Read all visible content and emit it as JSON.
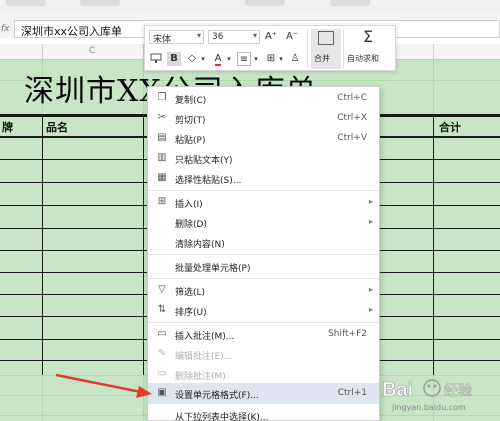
{
  "formula_bar": {
    "fx": "fx",
    "value": "深圳市xx公司入库单"
  },
  "columns": {
    "c": "C"
  },
  "sheet": {
    "title": "深圳市XX公司入库单",
    "headers": {
      "col1": "牌",
      "col2": "品名",
      "col3": "合计"
    }
  },
  "mini_toolbar": {
    "font_name": "宋体",
    "font_size": "36",
    "increase_font": "A⁺",
    "decrease_font": "A⁻",
    "bold": "B",
    "merge_label": "合并",
    "autosum_label": "自动求和"
  },
  "context_menu": {
    "items": [
      {
        "label": "复制(C)",
        "shortcut": "Ctrl+C",
        "icon": "copy-icon"
      },
      {
        "label": "剪切(T)",
        "shortcut": "Ctrl+X",
        "icon": "scissors-icon"
      },
      {
        "label": "粘贴(P)",
        "shortcut": "Ctrl+V",
        "icon": "paste-icon"
      },
      {
        "label": "只粘贴文本(Y)",
        "shortcut": "",
        "icon": "paste-text-icon"
      },
      {
        "label": "选择性粘贴(S)...",
        "shortcut": "",
        "icon": "paste-special-icon"
      },
      {
        "label": "插入(I)",
        "shortcut": "",
        "icon": "insert-cells-icon"
      },
      {
        "label": "删除(D)",
        "shortcut": "",
        "icon": ""
      },
      {
        "label": "清除内容(N)",
        "shortcut": "",
        "icon": ""
      },
      {
        "label": "批量处理单元格(P)",
        "shortcut": "",
        "icon": ""
      },
      {
        "label": "筛选(L)",
        "shortcut": "",
        "icon": "filter-icon"
      },
      {
        "label": "排序(U)",
        "shortcut": "",
        "icon": "sort-icon"
      },
      {
        "label": "插入批注(M)...",
        "shortcut": "Shift+F2",
        "icon": "comment-icon"
      },
      {
        "label": "编辑批注(E)...",
        "shortcut": "",
        "icon": "edit-comment-icon"
      },
      {
        "label": "删除批注(M)",
        "shortcut": "",
        "icon": "delete-comment-icon"
      },
      {
        "label": "设置单元格格式(F)...",
        "shortcut": "Ctrl+1",
        "icon": "format-cells-icon"
      },
      {
        "label": "从下拉列表中选择(K)...",
        "shortcut": "",
        "icon": ""
      }
    ]
  },
  "watermark": {
    "text": "Bai 经验",
    "subtext": "jingyan.baidu.com"
  },
  "colors": {
    "sheet_bg": "#c8e5c6",
    "highlight": "#dde6ef",
    "arrow": "#e23a30"
  }
}
